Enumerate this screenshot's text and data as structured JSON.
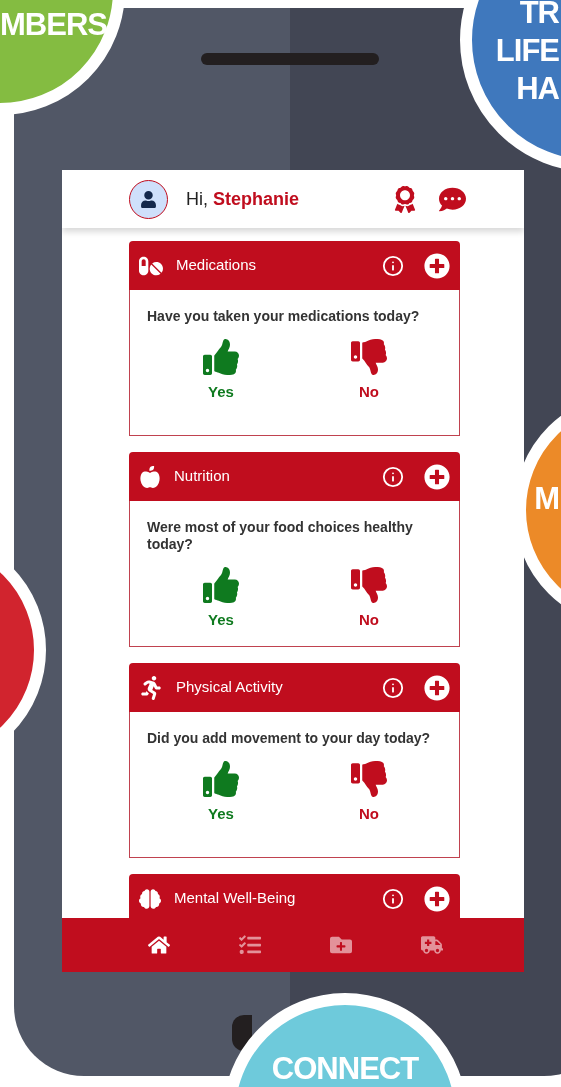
{
  "greeting": {
    "prefix": "Hi,",
    "name": "Stephanie"
  },
  "cards": [
    {
      "kind": "pills",
      "title": "Medications",
      "question": "Have you taken your medications today?",
      "options": [
        {
          "kind": "yes",
          "label": "Yes"
        },
        {
          "kind": "no",
          "label": "No"
        }
      ]
    },
    {
      "kind": "nutrition",
      "title": "Nutrition",
      "question": "Were most of your food choices healthy today?",
      "options": [
        {
          "kind": "yes",
          "label": "Yes"
        },
        {
          "kind": "no",
          "label": "No"
        }
      ]
    },
    {
      "kind": "running",
      "title": "Physical Activity",
      "question": "Did you add movement to your day today?",
      "options": [
        {
          "kind": "yes",
          "label": "Yes"
        },
        {
          "kind": "no",
          "label": "No"
        }
      ]
    },
    {
      "kind": "head",
      "title": "Mental Well-Being"
    }
  ],
  "nav": [
    {
      "kind": "home",
      "selected": true
    },
    {
      "kind": "checklist",
      "selected": false
    },
    {
      "kind": "folder",
      "selected": false
    },
    {
      "kind": "ambulance",
      "selected": false
    }
  ],
  "bubbles": [
    {
      "color": "#84bc41",
      "lines": [
        "MBERS"
      ]
    },
    {
      "color": "#3f78bd",
      "lines": [
        "TR",
        "LIFE",
        "HA"
      ]
    },
    {
      "color": "#ec8a28",
      "lines": [
        "M"
      ]
    },
    {
      "color": "#d1242e"
    },
    {
      "color": "#6ecadb",
      "lines": [
        "CONNECT"
      ]
    }
  ]
}
